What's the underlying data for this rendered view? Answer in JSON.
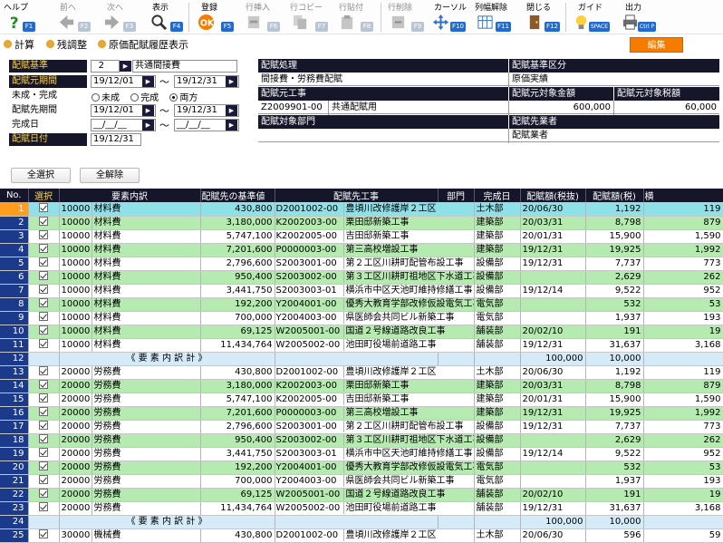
{
  "toolbar": {
    "items": [
      {
        "label": "ヘルプ",
        "key": "F1",
        "icon": "question-icon",
        "enabled": true
      },
      {
        "label": "前へ",
        "key": "F2",
        "icon": "arrow-left-icon",
        "enabled": false
      },
      {
        "label": "次へ",
        "key": "F3",
        "icon": "arrow-right-icon",
        "enabled": false
      },
      {
        "label": "表示",
        "key": "F4",
        "icon": "magnifier-icon",
        "enabled": true
      },
      {
        "label": "登録",
        "key": "F5",
        "icon": "ok-icon",
        "enabled": true
      },
      {
        "label": "行挿入",
        "key": "F6",
        "icon": "row-insert-icon",
        "enabled": false
      },
      {
        "label": "行コピー",
        "key": "F7",
        "icon": "row-copy-icon",
        "enabled": false
      },
      {
        "label": "行貼付",
        "key": "F8",
        "icon": "row-paste-icon",
        "enabled": false
      },
      {
        "label": "行削除",
        "key": "F9",
        "icon": "row-delete-icon",
        "enabled": false
      },
      {
        "label": "カーソル",
        "key": "F10",
        "icon": "cursor-icon",
        "enabled": true
      },
      {
        "label": "列幅解除",
        "key": "F11",
        "icon": "column-width-icon",
        "enabled": true
      },
      {
        "label": "閉じる",
        "key": "F12",
        "icon": "close-door-icon",
        "enabled": true
      },
      {
        "label": "ガイド",
        "key": "SPACE",
        "icon": "lightbulb-icon",
        "enabled": true
      },
      {
        "label": "出力",
        "key": "Ctrl P",
        "icon": "printer-icon",
        "enabled": true
      }
    ]
  },
  "subbar": {
    "calc": "計算",
    "adjust": "残調整",
    "history": "原価配賦履歴表示",
    "edit": "編集"
  },
  "conditions": {
    "basis_label": "配賦基準",
    "basis_code": "2",
    "basis_name": "共通間接費",
    "src_period_label": "配賦元期間",
    "src_period_from": "19/12/01",
    "src_period_to": "19/12/31",
    "status_label": "未成・完成",
    "status_options": [
      "未成",
      "完成",
      "両方"
    ],
    "dst_period_label": "配賦先期間",
    "dst_period_from": "19/12/01",
    "dst_period_to": "19/12/31",
    "completion_label": "完成日",
    "completion_from": "__/__/__",
    "completion_to": "__/__/__",
    "date_label": "配賦日付",
    "date_value": "19/12/31"
  },
  "info": {
    "process_label": "配賦処理",
    "process_value": "間接費・労務費配賦",
    "category_label": "配賦基準区分",
    "category_value": "原価実績",
    "src_work_label": "配賦元工事",
    "src_work_code": "Z2009901-00",
    "src_work_name": "共通配賦用",
    "src_amount_label": "配賦元対象金額",
    "src_amount_value": "600,000",
    "src_tax_label": "配賦元対象税額",
    "src_tax_value": "60,000",
    "dept_label": "配賦対象部門",
    "dept_value": "",
    "dst_label": "配賦先業者",
    "dst_value": "配賦業者"
  },
  "buttons": {
    "select_all": "全選択",
    "clear_all": "全解除"
  },
  "grid": {
    "headers": [
      "No.",
      "選択",
      "要素内訳",
      "配賦先の基準値",
      "配賦先工事",
      "部門",
      "完成日",
      "配賦額(税抜)",
      "配賦額(税)",
      "横"
    ],
    "rows": [
      {
        "no": "1",
        "type": "data",
        "code": "10000",
        "name": "材料費",
        "base": "430,800",
        "work_code": "D2001002-00",
        "work_name": "豊頃川改修護岸２工区",
        "dept": "土木部",
        "done": "20/06/30",
        "amt": "1,192",
        "tax": "119"
      },
      {
        "no": "2",
        "type": "data",
        "code": "10000",
        "name": "材料費",
        "base": "3,180,000",
        "work_code": "K2002003-00",
        "work_name": "栗田邸新築工事",
        "dept": "建築部",
        "done": "20/03/31",
        "amt": "8,798",
        "tax": "879"
      },
      {
        "no": "3",
        "type": "data",
        "code": "10000",
        "name": "材料費",
        "base": "5,747,100",
        "work_code": "K2002005-00",
        "work_name": "吉田邸新築工事",
        "dept": "建築部",
        "done": "20/01/31",
        "amt": "15,900",
        "tax": "1,590"
      },
      {
        "no": "4",
        "type": "data",
        "code": "10000",
        "name": "材料費",
        "base": "7,201,600",
        "work_code": "P0000003-00",
        "work_name": "第三高校増設工事",
        "dept": "建築部",
        "done": "19/12/31",
        "amt": "19,925",
        "tax": "1,992"
      },
      {
        "no": "5",
        "type": "data",
        "code": "10000",
        "name": "材料費",
        "base": "2,796,600",
        "work_code": "S2003001-00",
        "work_name": "第２工区川耕町配管布設工事",
        "dept": "設備部",
        "done": "19/12/31",
        "amt": "7,737",
        "tax": "773"
      },
      {
        "no": "6",
        "type": "data",
        "code": "10000",
        "name": "材料費",
        "base": "950,400",
        "work_code": "S2003002-00",
        "work_name": "第３工区川耕町祖地区下水道工事",
        "dept": "設備部",
        "done": "",
        "amt": "2,629",
        "tax": "262"
      },
      {
        "no": "7",
        "type": "data",
        "code": "10000",
        "name": "材料費",
        "base": "3,441,750",
        "work_code": "S2003003-01",
        "work_name": "横浜市中区天池町維持修繕工事",
        "dept": "設備部",
        "done": "19/12/14",
        "amt": "9,522",
        "tax": "952"
      },
      {
        "no": "8",
        "type": "data",
        "code": "10000",
        "name": "材料費",
        "base": "192,200",
        "work_code": "Y2004001-00",
        "work_name": "優秀大教育学部改修仮設電気工事",
        "dept": "電気部",
        "done": "",
        "amt": "532",
        "tax": "53"
      },
      {
        "no": "9",
        "type": "data",
        "code": "10000",
        "name": "材料費",
        "base": "700,000",
        "work_code": "Y2004003-00",
        "work_name": "県医師会共同ビル新築工事",
        "dept": "電気部",
        "done": "",
        "amt": "1,937",
        "tax": "193"
      },
      {
        "no": "10",
        "type": "data",
        "code": "10000",
        "name": "材料費",
        "base": "69,125",
        "work_code": "W2005001-00",
        "work_name": "国道２号線道路改良工事",
        "dept": "舗装部",
        "done": "20/02/10",
        "amt": "191",
        "tax": "19"
      },
      {
        "no": "11",
        "type": "data",
        "code": "10000",
        "name": "材料費",
        "base": "11,434,764",
        "work_code": "W2005002-00",
        "work_name": "池田町役場前道路工事",
        "dept": "舗装部",
        "done": "19/12/31",
        "amt": "31,637",
        "tax": "3,168"
      },
      {
        "no": "12",
        "type": "sum",
        "label": "《 要 素 内 訳 計 》",
        "amt": "100,000",
        "tax": "10,000"
      },
      {
        "no": "13",
        "type": "data",
        "code": "20000",
        "name": "労務費",
        "base": "430,800",
        "work_code": "D2001002-00",
        "work_name": "豊頃川改修護岸２工区",
        "dept": "土木部",
        "done": "20/06/30",
        "amt": "1,192",
        "tax": "119"
      },
      {
        "no": "14",
        "type": "data",
        "code": "20000",
        "name": "労務費",
        "base": "3,180,000",
        "work_code": "K2002003-00",
        "work_name": "栗田邸新築工事",
        "dept": "建築部",
        "done": "20/03/31",
        "amt": "8,798",
        "tax": "879"
      },
      {
        "no": "15",
        "type": "data",
        "code": "20000",
        "name": "労務費",
        "base": "5,747,100",
        "work_code": "K2002005-00",
        "work_name": "吉田邸新築工事",
        "dept": "建築部",
        "done": "20/01/31",
        "amt": "15,900",
        "tax": "1,590"
      },
      {
        "no": "16",
        "type": "data",
        "code": "20000",
        "name": "労務費",
        "base": "7,201,600",
        "work_code": "P0000003-00",
        "work_name": "第三高校増設工事",
        "dept": "建築部",
        "done": "19/12/31",
        "amt": "19,925",
        "tax": "1,992"
      },
      {
        "no": "17",
        "type": "data",
        "code": "20000",
        "name": "労務費",
        "base": "2,796,600",
        "work_code": "S2003001-00",
        "work_name": "第２工区川耕町配管布設工事",
        "dept": "設備部",
        "done": "19/12/31",
        "amt": "7,737",
        "tax": "773"
      },
      {
        "no": "18",
        "type": "data",
        "code": "20000",
        "name": "労務費",
        "base": "950,400",
        "work_code": "S2003002-00",
        "work_name": "第３工区川耕町祖地区下水道工事",
        "dept": "設備部",
        "done": "",
        "amt": "2,629",
        "tax": "262"
      },
      {
        "no": "19",
        "type": "data",
        "code": "20000",
        "name": "労務費",
        "base": "3,441,750",
        "work_code": "S2003003-01",
        "work_name": "横浜市中区天池町維持修繕工事",
        "dept": "設備部",
        "done": "19/12/14",
        "amt": "9,522",
        "tax": "952"
      },
      {
        "no": "20",
        "type": "data",
        "code": "20000",
        "name": "労務費",
        "base": "192,200",
        "work_code": "Y2004001-00",
        "work_name": "優秀大教育学部改修仮設電気工事",
        "dept": "電気部",
        "done": "",
        "amt": "532",
        "tax": "53"
      },
      {
        "no": "21",
        "type": "data",
        "code": "20000",
        "name": "労務費",
        "base": "700,000",
        "work_code": "Y2004003-00",
        "work_name": "県医師会共同ビル新築工事",
        "dept": "電気部",
        "done": "",
        "amt": "1,937",
        "tax": "193"
      },
      {
        "no": "22",
        "type": "data",
        "code": "20000",
        "name": "労務費",
        "base": "69,125",
        "work_code": "W2005001-00",
        "work_name": "国道２号線道路改良工事",
        "dept": "舗装部",
        "done": "20/02/10",
        "amt": "191",
        "tax": "19"
      },
      {
        "no": "23",
        "type": "data",
        "code": "20000",
        "name": "労務費",
        "base": "11,434,764",
        "work_code": "W2005002-00",
        "work_name": "池田町役場前道路工事",
        "dept": "舗装部",
        "done": "19/12/31",
        "amt": "31,637",
        "tax": "3,168"
      },
      {
        "no": "24",
        "type": "sum",
        "label": "《 要 素 内 訳 計 》",
        "amt": "100,000",
        "tax": "10,000"
      },
      {
        "no": "25",
        "type": "data",
        "code": "30000",
        "name": "機械費",
        "base": "430,800",
        "work_code": "D2001002-00",
        "work_name": "豊頃川改修護岸２工区",
        "dept": "土木部",
        "done": "20/06/30",
        "amt": "596",
        "tax": "59"
      }
    ]
  },
  "colors": {
    "header_bg": "#16162b",
    "label_yellow": "#ffd23d",
    "row_green": "#b5eab0",
    "current_row": "#8fe1e8",
    "sum_row": "#d5ecf8",
    "edit_orange": "#f57c00"
  }
}
